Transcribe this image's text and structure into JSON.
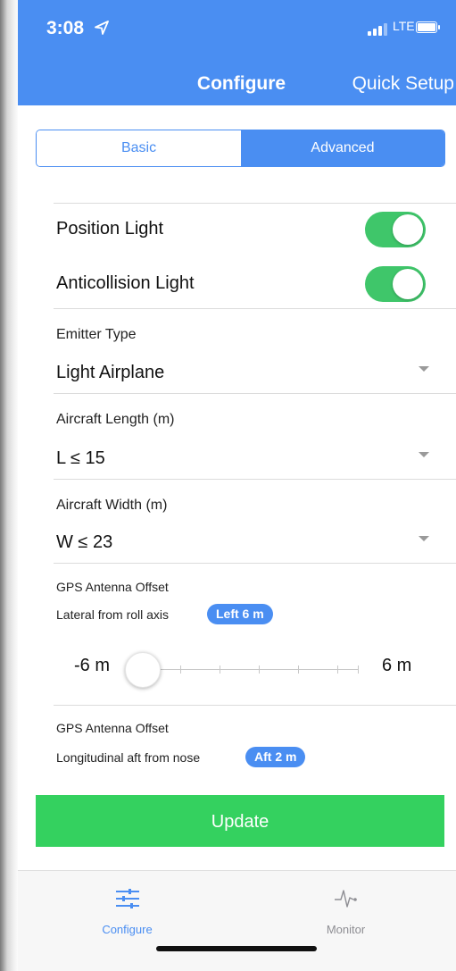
{
  "status_bar": {
    "time": "3:08",
    "carrier": "LTE",
    "location_icon": "location-arrow-icon",
    "signal_icon": "signal-icon",
    "battery_icon": "battery-icon"
  },
  "nav": {
    "title": "Configure",
    "right_action": "Quick Setup"
  },
  "segments": {
    "basic": "Basic",
    "advanced": "Advanced",
    "selected": "Advanced"
  },
  "toggles": [
    {
      "label": "Position Light",
      "on": true
    },
    {
      "label": "Anticollision Light",
      "on": true
    }
  ],
  "fields": [
    {
      "label": "Emitter Type",
      "value": "Light Airplane"
    },
    {
      "label": "Aircraft Length (m)",
      "value": "L ≤ 15"
    },
    {
      "label": "Aircraft Width (m)",
      "value": "W ≤ 23"
    }
  ],
  "gps_lateral": {
    "title": "GPS Antenna Offset",
    "subtitle": "Lateral from roll axis",
    "badge": "Left 6 m",
    "min_label": "-6 m",
    "max_label": "6 m",
    "value_m": -6,
    "range_m": [
      -6,
      6
    ],
    "tick_step_m": 2
  },
  "gps_longitudinal": {
    "title": "GPS Antenna Offset",
    "subtitle": "Longitudinal aft from nose",
    "badge": "Aft 2 m"
  },
  "update_button": "Update",
  "tabs": [
    {
      "label": "Configure",
      "icon": "sliders-icon",
      "active": true
    },
    {
      "label": "Monitor",
      "icon": "pulse-icon",
      "active": false
    }
  ],
  "colors": {
    "accent": "#4a8ef2",
    "toggle_on": "#3fc66a",
    "update_button": "#34d15f",
    "tab_inactive": "#8e8e93"
  }
}
